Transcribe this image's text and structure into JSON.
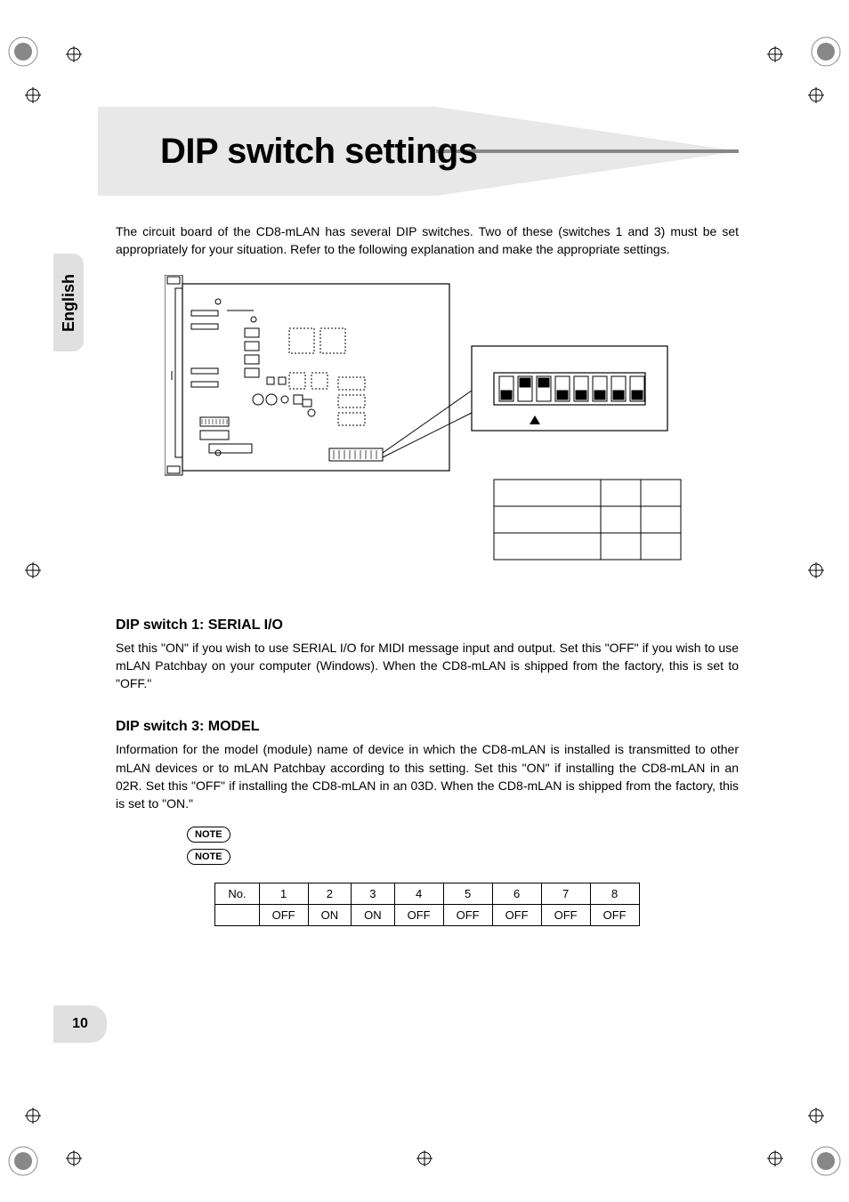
{
  "sidebar_label": "English",
  "page_number": "10",
  "title": "DIP switch settings",
  "intro": "The circuit board of the CD8-mLAN has several DIP switches. Two of these (switches 1 and 3) must be set appropriately for your situation. Refer to the following explanation and make the appropriate settings.",
  "section1": {
    "title": "DIP switch 1: SERIAL I/O",
    "body": "Set this \"ON\" if you wish to use SERIAL I/O for MIDI message input and output. Set this \"OFF\" if you wish to use mLAN Patchbay on your computer (Windows). When the CD8-mLAN is shipped from the factory, this is set to \"OFF.\""
  },
  "section2": {
    "title": "DIP switch 3: MODEL",
    "body": "Information for the model (module) name of device in which the CD8-mLAN is installed is transmitted to other mLAN devices or to mLAN Patchbay according to this setting. Set this \"ON\" if installing the CD8-mLAN in an 02R. Set this \"OFF\" if installing the CD8-mLAN in an 03D. When the CD8-mLAN is shipped from the factory, this is set to \"ON.\""
  },
  "note_label": "NOTE",
  "table": {
    "header": [
      "No.",
      "1",
      "2",
      "3",
      "4",
      "5",
      "6",
      "7",
      "8"
    ],
    "row": [
      "",
      "OFF",
      "ON",
      "ON",
      "OFF",
      "OFF",
      "OFF",
      "OFF",
      "OFF"
    ]
  }
}
